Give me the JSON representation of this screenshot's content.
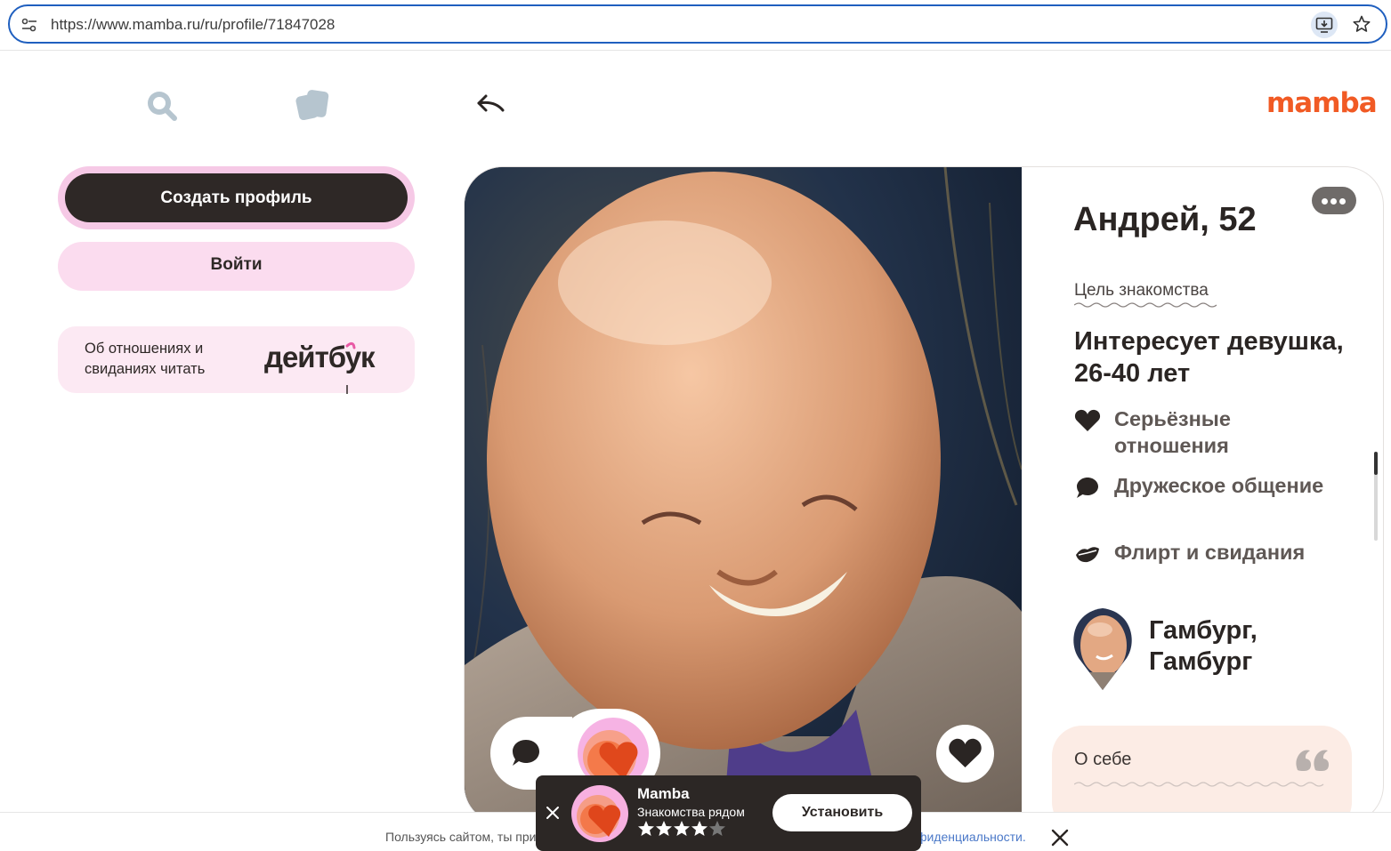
{
  "browser": {
    "url": "https://www.mamba.ru/ru/profile/71847028",
    "icons": [
      "tune-icon",
      "install-app-icon",
      "bookmark-star-icon"
    ]
  },
  "nav": {
    "icons": [
      "search-icon",
      "cards-icon",
      "back-arrow-icon"
    ],
    "logo": "mamba",
    "brand_color": "#f15a24"
  },
  "sidebar": {
    "create_profile": "Создать профиль",
    "login": "Войти",
    "datebook": {
      "text": "Об отношениях и свиданиях читать",
      "brand": "дейтбук"
    }
  },
  "profile": {
    "name_age": "Андрей, 52",
    "goal_label": "Цель знакомства",
    "interest": "Интересует девушка, 26-40 лет",
    "goals": [
      {
        "label": "Серьёзные отношения",
        "icon": "heart-icon"
      },
      {
        "label": "Дружеское общение",
        "icon": "chat-bubble-icon"
      },
      {
        "label": "Флирт и свидания",
        "icon": "lips-icon"
      }
    ],
    "location": "Гамбург, Гамбург",
    "about_label": "О себе"
  },
  "actions": {
    "icons": [
      "chat-icon",
      "mamba-heart-icon",
      "like-heart-icon",
      "more-icon"
    ]
  },
  "cookie": {
    "text_start": "Пользуясь сайтом, ты при",
    "text_link": "фиденциальности."
  },
  "app_banner": {
    "name": "Mamba",
    "subtitle": "Знакомства рядом",
    "rating": 4.5,
    "install": "Установить"
  }
}
